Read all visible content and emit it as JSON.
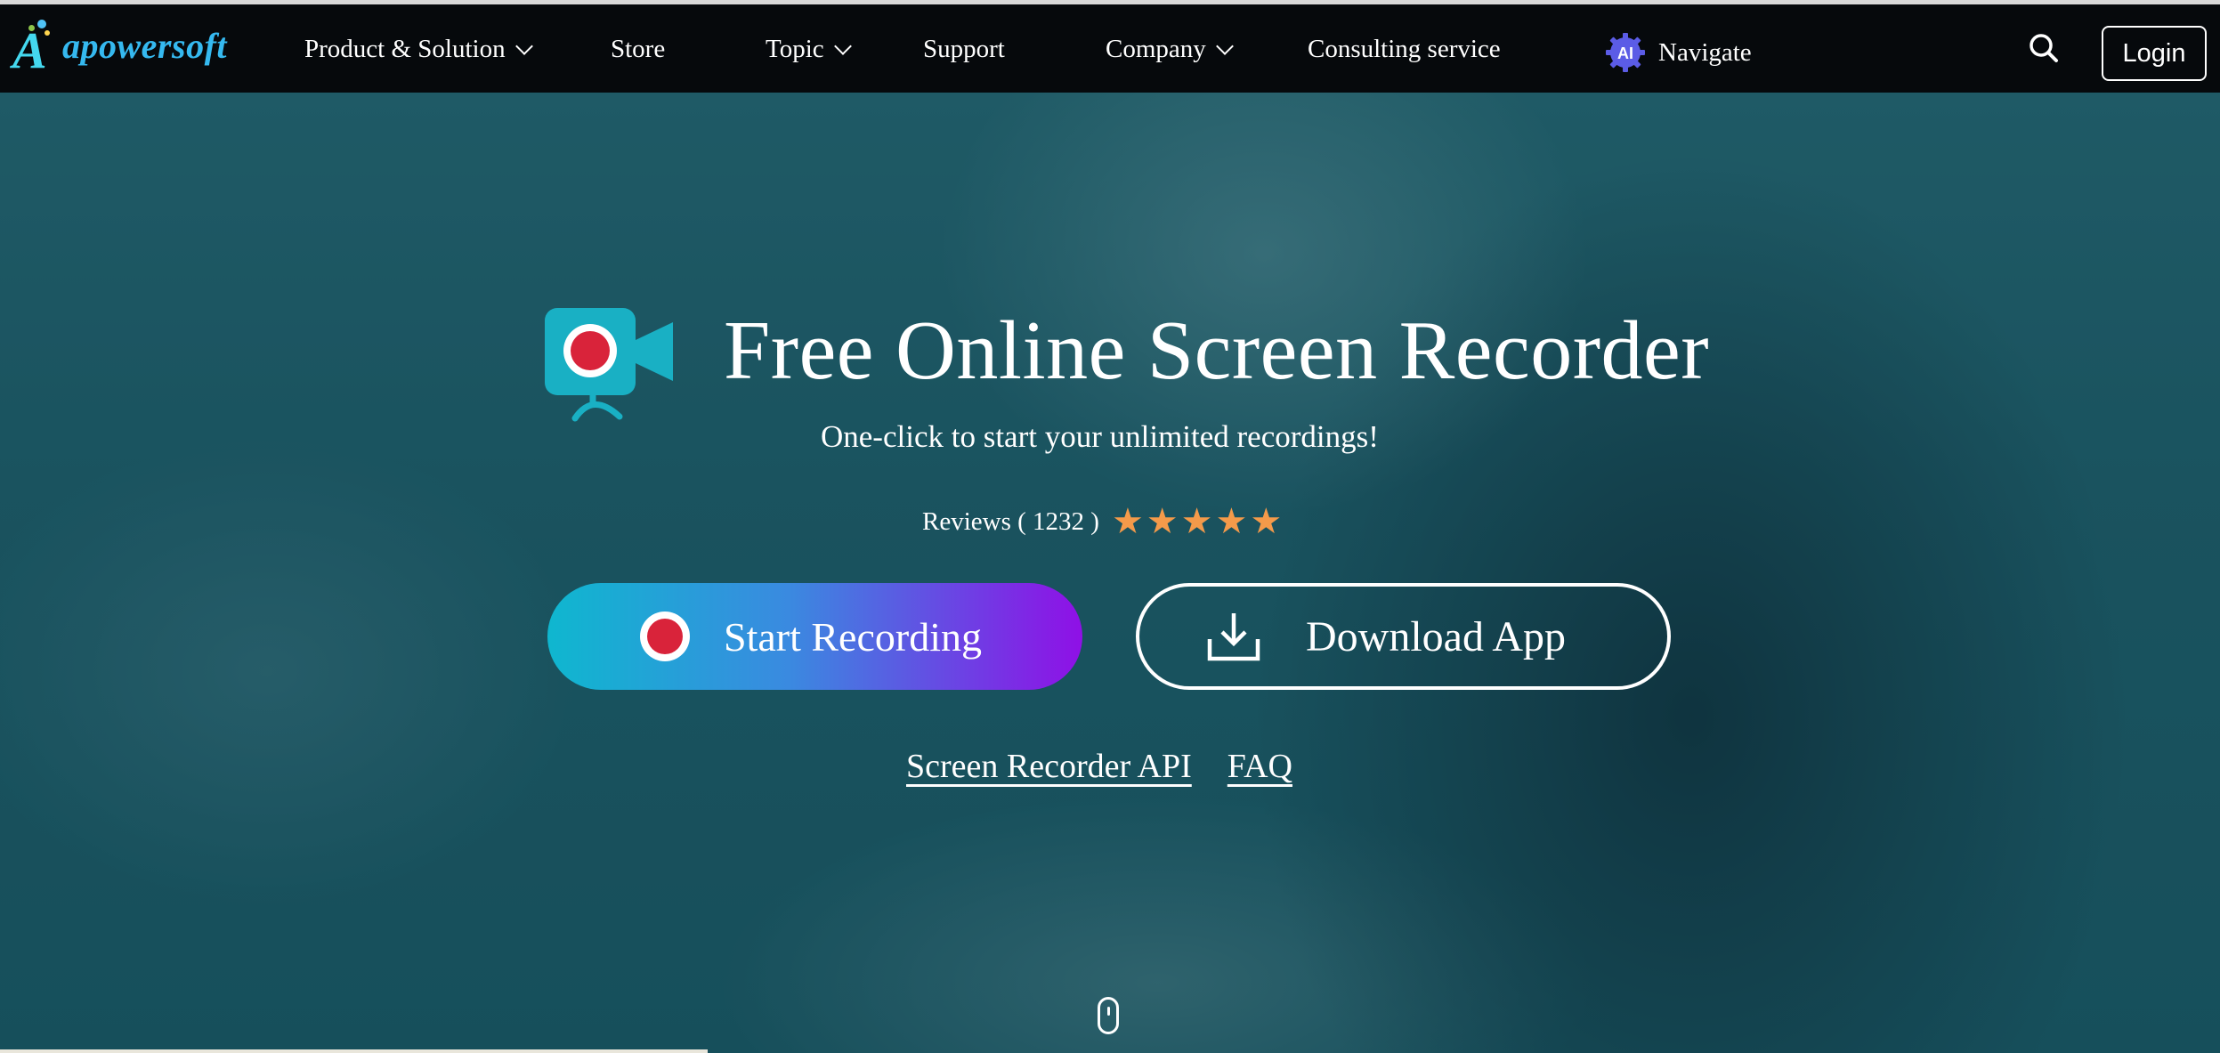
{
  "brand": {
    "name": "apowersoft",
    "logo_letter": "A",
    "colors": {
      "logo": "#35b9f0",
      "accent_gradient_start": "#0fb7cf",
      "accent_gradient_end": "#8f10e6",
      "star": "#f49a4a",
      "record": "#d9233a"
    }
  },
  "nav": {
    "items": [
      {
        "label": "Product & Solution",
        "has_dropdown": true
      },
      {
        "label": "Store",
        "has_dropdown": false
      },
      {
        "label": "Topic",
        "has_dropdown": true
      },
      {
        "label": "Support",
        "has_dropdown": false
      },
      {
        "label": "Company",
        "has_dropdown": true
      },
      {
        "label": "Consulting service",
        "has_dropdown": false
      }
    ],
    "ai_badge": "AI",
    "ai_label": "Navigate",
    "search_icon": "search-icon",
    "login_label": "Login"
  },
  "hero": {
    "icon": "video-camera-record-icon",
    "title": "Free Online Screen Recorder",
    "subtitle": "One-click to start your unlimited recordings!",
    "reviews_label": "Reviews ( 1232 )",
    "rating": 5,
    "star_glyph": "★",
    "start_button": "Start Recording",
    "download_button": "Download App",
    "links": [
      "Screen Recorder API",
      "FAQ"
    ],
    "scroll_icon": "mouse-scroll-icon"
  }
}
